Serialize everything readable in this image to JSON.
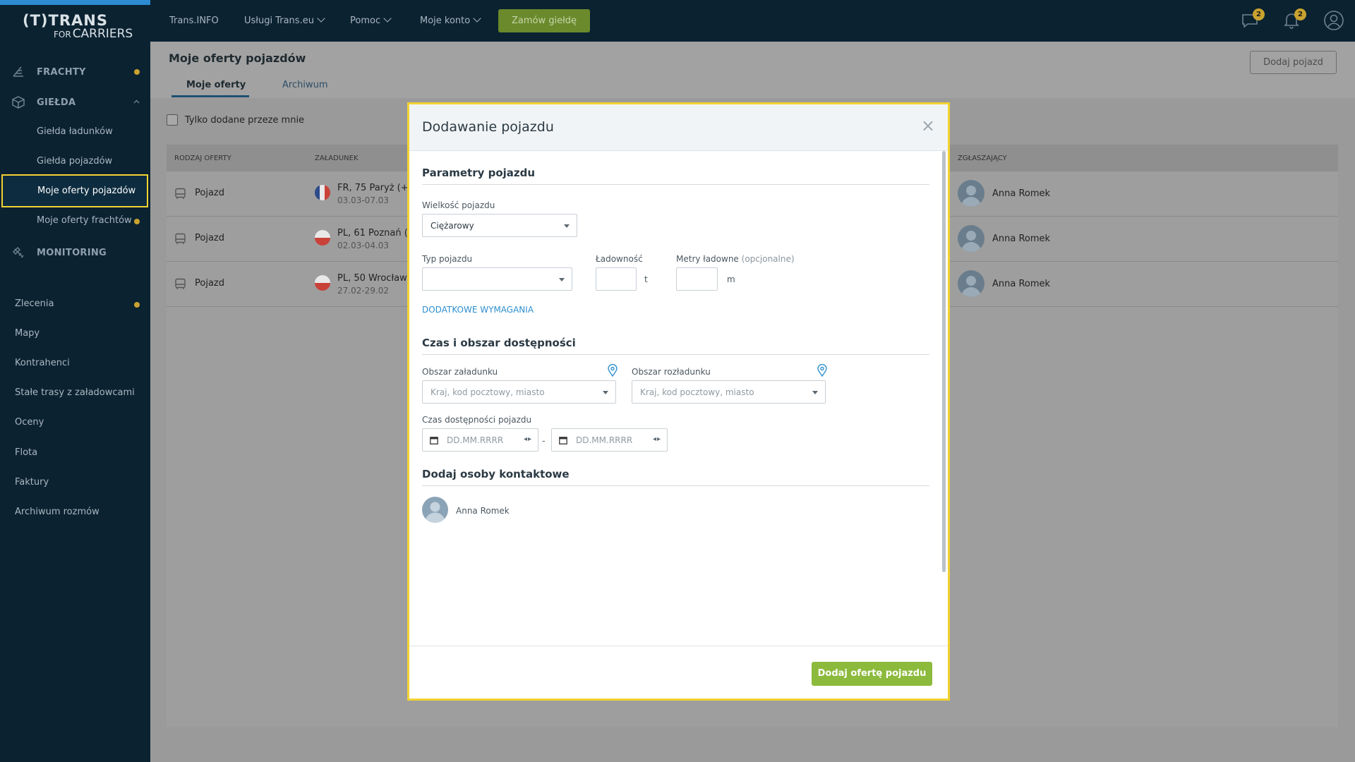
{
  "logo": {
    "line1": "(T)TRANS",
    "line2_small": "FOR",
    "line2": "CARRIERS"
  },
  "sidebar": {
    "main": [
      {
        "label": "FRACHTY",
        "icon": "freight-icon",
        "dot": true
      },
      {
        "label": "GIEŁDA",
        "icon": "box-icon",
        "expanded": true
      },
      {
        "label": "MONITORING",
        "icon": "satellite-icon"
      }
    ],
    "sub": [
      {
        "label": "Giełda ładunków"
      },
      {
        "label": "Giełda pojazdów"
      },
      {
        "label": "Moje oferty pojazdów",
        "active": true
      },
      {
        "label": "Moje oferty frachtów",
        "dot": true
      }
    ],
    "plain": [
      {
        "label": "Zlecenia",
        "dot": true
      },
      {
        "label": "Mapy"
      },
      {
        "label": "Kontrahenci"
      },
      {
        "label": "Stałe trasy z załadowcami"
      },
      {
        "label": "Oceny"
      },
      {
        "label": "Flota"
      },
      {
        "label": "Faktury"
      },
      {
        "label": "Archiwum rozmów"
      }
    ]
  },
  "topbar": {
    "links": [
      "Trans.INFO",
      "Usługi Trans.eu",
      "Pomoc",
      "Moje konto"
    ],
    "order_button": "Zamów giełdę",
    "messages_badge": "2",
    "notifications_badge": "2"
  },
  "page": {
    "title": "Moje oferty pojazdów",
    "tabs": [
      "Moje oferty",
      "Archiwum"
    ],
    "add_button": "Dodaj pojazd",
    "filter_label": "Tylko dodane przeze mnie"
  },
  "table": {
    "headers": [
      "RODZAJ OFERTY",
      "ZAŁADUNEK",
      "ZGŁASZAJĄCY"
    ],
    "rows": [
      {
        "type": "Pojazd",
        "flag": "FR",
        "place": "FR, 75 Paryż (+",
        "dates": "03.03-07.03",
        "person": "Anna Romek"
      },
      {
        "type": "Pojazd",
        "flag": "PL",
        "place": "PL, 61 Poznań (",
        "dates": "02.03-04.03",
        "person": "Anna Romek"
      },
      {
        "type": "Pojazd",
        "flag": "PL",
        "place": "PL, 50 Wrocław",
        "dates": "27.02-29.02",
        "person": "Anna Romek"
      }
    ]
  },
  "modal": {
    "title": "Dodawanie pojazdu",
    "close": "×",
    "section1": "Parametry pojazdu",
    "size_label": "Wielkość pojazdu",
    "size_value": "Ciężarowy",
    "type_label": "Typ pojazdu",
    "capacity_label": "Ładowność",
    "capacity_unit": "t",
    "meters_label": "Metry ładowne",
    "meters_optional": "(opcjonalne)",
    "meters_unit": "m",
    "extra_link": "DODATKOWE WYMAGANIA",
    "section2": "Czas i obszar dostępności",
    "load_area_label": "Obszar załadunku",
    "load_area_placeholder": "Kraj, kod pocztowy, miasto",
    "unload_area_label": "Obszar rozładunku",
    "unload_area_placeholder": "Kraj, kod pocztowy, miasto",
    "availability_label": "Czas dostępności pojazdu",
    "date_from_placeholder": "DD.MM.RRRR",
    "date_to_placeholder": "DD.MM.RRRR",
    "date_separator": "-",
    "section3": "Dodaj osoby kontaktowe",
    "contact_name": "Anna Romek",
    "submit": "Dodaj ofertę pojazdu"
  },
  "colors": {
    "accent_yellow": "#f2d232",
    "submit_green": "#8cba3c",
    "sidebar_bg": "#0b2231",
    "link_blue": "#2e8fcf"
  }
}
